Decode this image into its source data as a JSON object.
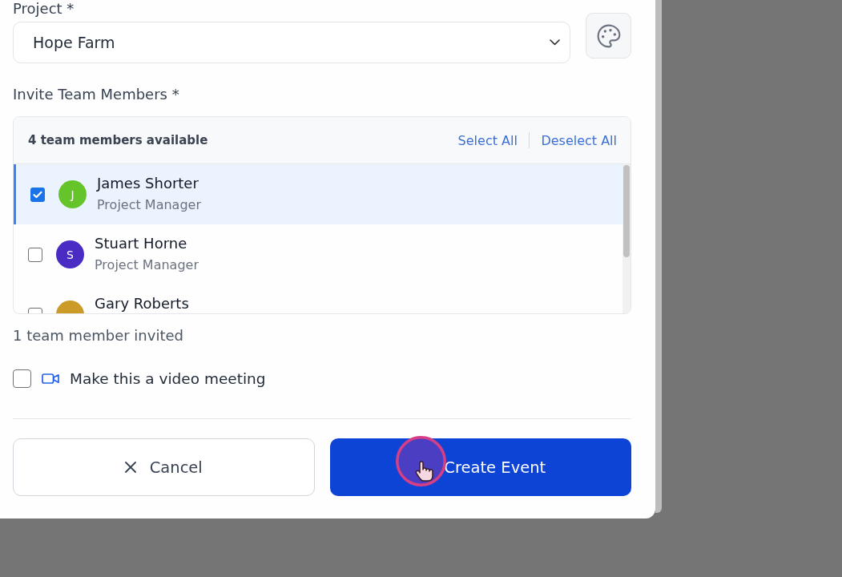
{
  "project": {
    "label": "Project *",
    "value": "Hope Farm"
  },
  "invite": {
    "label": "Invite Team Members *",
    "available": "4 team members available",
    "select_all": "Select All",
    "deselect_all": "Deselect All",
    "members": [
      {
        "name": "James Shorter",
        "role": "Project Manager",
        "initial": "J",
        "color": "#66c42b",
        "checked": true
      },
      {
        "name": "Stuart Horne",
        "role": "Project Manager",
        "initial": "S",
        "color": "#4a2bc4",
        "checked": false
      },
      {
        "name": "Gary Roberts",
        "color": "#cc9a26",
        "checked": false
      }
    ],
    "summary": "1 team member invited"
  },
  "video_meeting": {
    "label": "Make this a video meeting",
    "checked": false
  },
  "buttons": [
    {
      "kind": "secondary",
      "label": "Cancel"
    },
    {
      "kind": "primary",
      "label": "Create Event"
    }
  ]
}
